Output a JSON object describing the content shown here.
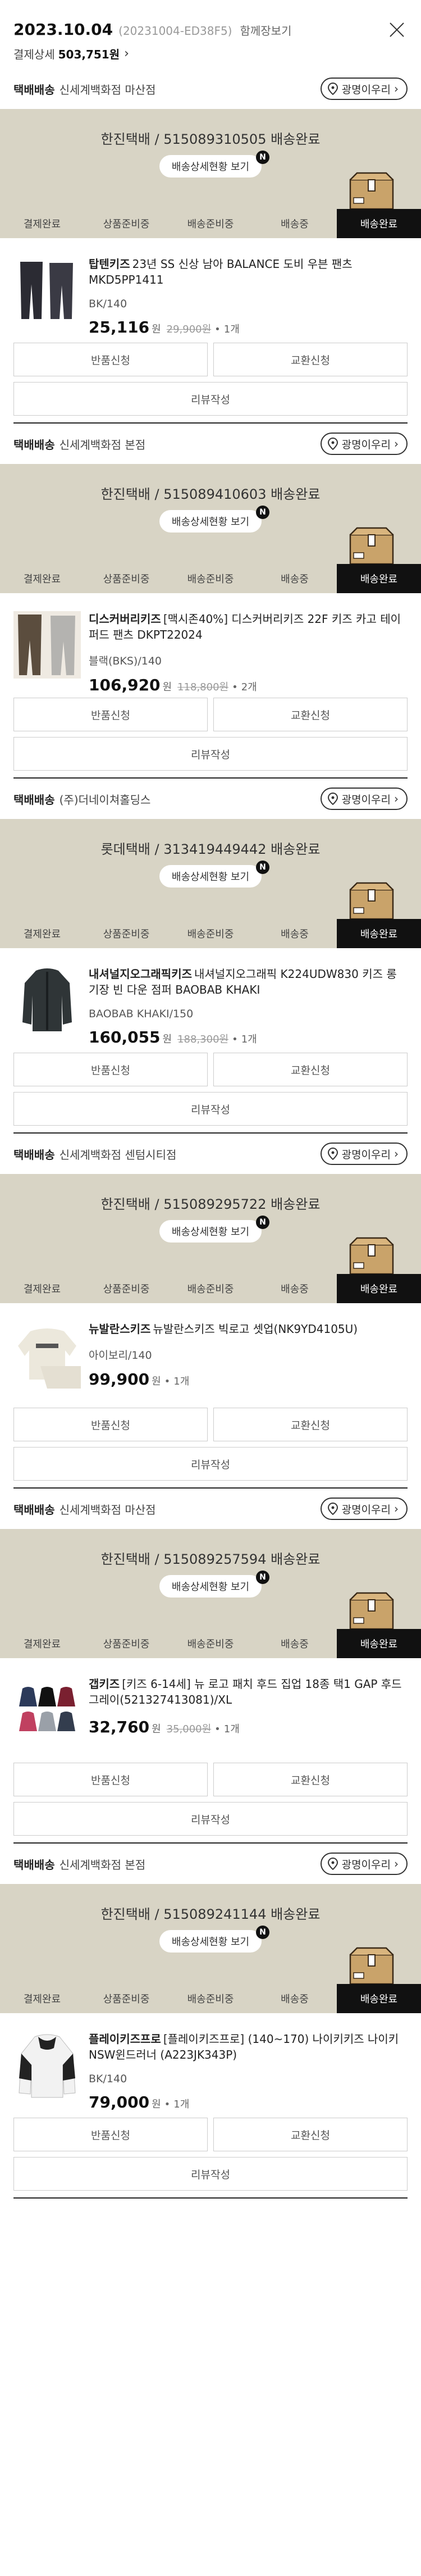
{
  "header": {
    "date": "2023.10.04",
    "code": "(20231004-ED38F5)",
    "cart_link": "함께장보기",
    "pay_label": "결제상세",
    "pay_amount": "503,751원",
    "arrow": "›"
  },
  "common": {
    "pill_label": "광명이우리",
    "detail_btn": "배송상세현황 보기",
    "new_badge": "N",
    "steps": [
      "결제완료",
      "상품준비중",
      "배송준비중",
      "배송중",
      "배송완료"
    ],
    "return_btn": "반품신청",
    "exchange_btn": "교환신청",
    "review_btn": "리뷰작성",
    "won": "원",
    "bullet": "•"
  },
  "shipments": [
    {
      "type": "택배배송",
      "store": "신세계백화점 마산점",
      "carrier": "한진택배 / 515089310505 배송완료",
      "brand": "탑텐키즈",
      "product": "23년 SS 신상 남아 BALANCE 도비 우븐 팬츠 MKD5PP1411",
      "option": "BK/140",
      "price": "25,116",
      "original": "29,900원",
      "qty": "1개",
      "thumb": "pants-dark"
    },
    {
      "type": "택배배송",
      "store": "신세계백화점 본점",
      "carrier": "한진택배 / 515089410603 배송완료",
      "brand": "디스커버리키즈",
      "product": "[맥시존40%] 디스커버리키즈 22F 키즈 카고 테이퍼드 팬츠 DKPT22024",
      "option": "블랙(BKS)/140",
      "price": "106,920",
      "original": "118,800원",
      "qty": "2개",
      "thumb": "pants-gray"
    },
    {
      "type": "택배배송",
      "store": "(주)더네이쳐홀딩스",
      "carrier": "롯데택배 / 313419449442 배송완료",
      "brand": "내셔널지오그래픽키즈",
      "product": "내셔널지오그래픽 K224UDW830 키즈 롱 기장 빈 다운 점퍼 BAOBAB KHAKI",
      "option": "BAOBAB KHAKI/150",
      "price": "160,055",
      "original": "188,300원",
      "qty": "1개",
      "thumb": "jacket"
    },
    {
      "type": "택배배송",
      "store": "신세계백화점 센텀시티점",
      "carrier": "한진택배 / 515089295722 배송완료",
      "brand": "뉴발란스키즈",
      "product": "뉴발란스키즈 빅로고 셋업(NK9YD4105U)",
      "option": "아이보리/140",
      "price": "99,900",
      "original": "",
      "qty": "1개",
      "thumb": "sweater"
    },
    {
      "type": "택배배송",
      "store": "신세계백화점 마산점",
      "carrier": "한진택배 / 515089257594 배송완료",
      "brand": "갭키즈",
      "product": "[키즈 6-14세] 뉴 로고 패치 후드 집업 18종 택1 GAP 후드 그레이(521327413081)/XL",
      "option": "",
      "price": "32,760",
      "original": "35,000원",
      "qty": "1개",
      "thumb": "hoodies"
    },
    {
      "type": "택배배송",
      "store": "신세계백화점 본점",
      "carrier": "한진택배 / 515089241144 배송완료",
      "brand": "플레이키즈프로",
      "product": "[플레이키즈프로] (140~170) 나이키키즈 나이키NSW윈드러너 (A223JK343P)",
      "option": "BK/140",
      "price": "79,000",
      "original": "",
      "qty": "1개",
      "thumb": "windrunner"
    }
  ]
}
